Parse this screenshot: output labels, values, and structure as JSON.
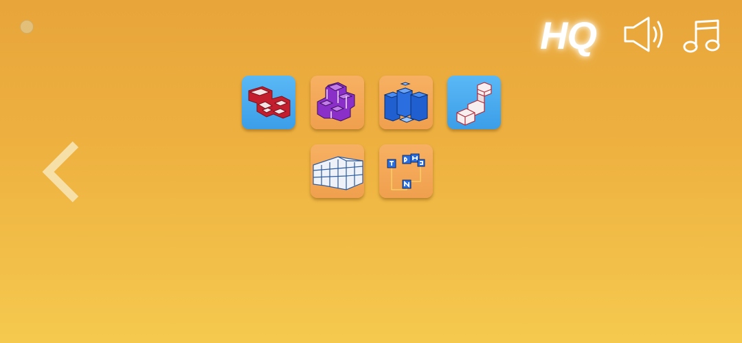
{
  "header": {
    "quality_label": "HQ",
    "icons": [
      "sound-icon",
      "music-note-icon"
    ]
  },
  "navigation": {
    "back_icon": "chevron-left-icon"
  },
  "levels": [
    {
      "theme": "red-block-puzzle",
      "color": "blue"
    },
    {
      "theme": "purple-block-puzzle",
      "color": "orange"
    },
    {
      "theme": "blue-tower-puzzle",
      "color": "orange"
    },
    {
      "theme": "white-stairs-puzzle",
      "color": "blue"
    },
    {
      "theme": "white-wall-puzzle",
      "color": "orange"
    },
    {
      "theme": "letter-blocks-puzzle",
      "color": "orange"
    }
  ],
  "colors": {
    "background_top": "#e8a53a",
    "background_bottom": "#f5c94e",
    "tile_blue": "#4aaaf0",
    "tile_orange": "#f3a858"
  }
}
